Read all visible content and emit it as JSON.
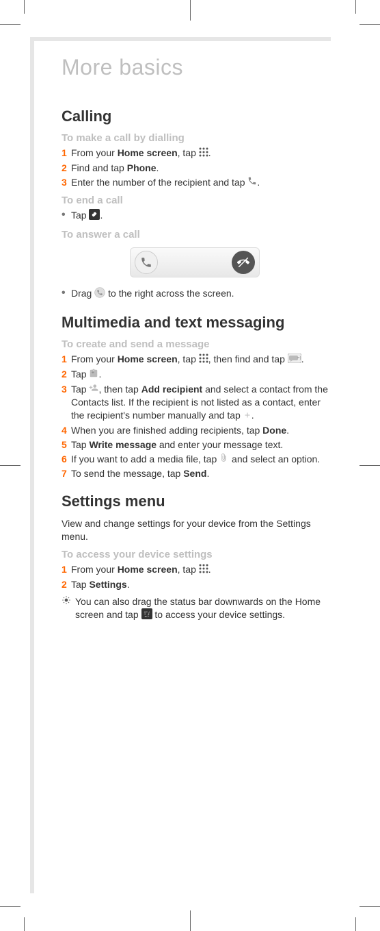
{
  "pageTitle": "More basics",
  "sections": {
    "calling": {
      "heading": "Calling",
      "subs": {
        "dial": {
          "heading": "To make a call by dialling"
        },
        "end": {
          "heading": "To end a call"
        },
        "answer": {
          "heading": "To answer a call"
        }
      },
      "dialSteps": {
        "s1a": "From your ",
        "s1b": "Home screen",
        "s1c": ", tap ",
        "s1d": ".",
        "s2a": "Find and tap ",
        "s2b": "Phone",
        "s2c": ".",
        "s3a": "Enter the number of the recipient and tap ",
        "s3b": "."
      },
      "endStep": {
        "a": "Tap ",
        "b": "."
      },
      "answerStep": {
        "a": "Drag ",
        "b": " to the right across the screen."
      }
    },
    "messaging": {
      "heading": "Multimedia and text messaging",
      "create": {
        "heading": "To create and send a message"
      },
      "steps": {
        "s1a": "From your ",
        "s1b": "Home screen",
        "s1c": ", tap ",
        "s1d": ", then find and tap ",
        "s1e": ".",
        "s2a": "Tap ",
        "s2b": ".",
        "s3a": "Tap ",
        "s3b": ", then tap ",
        "s3c": "Add recipient",
        "s3d": " and select a contact from the Contacts list. If the recipient is not listed as a contact, enter the recipient's number manually and tap ",
        "s3e": ".",
        "s4a": "When you are finished adding recipients, tap ",
        "s4b": "Done",
        "s4c": ".",
        "s5a": "Tap ",
        "s5b": "Write message",
        "s5c": " and enter your message text.",
        "s6a": "If you want to add a media file, tap ",
        "s6b": " and select an option.",
        "s7a": "To send the message, tap ",
        "s7b": "Send",
        "s7c": "."
      }
    },
    "settings": {
      "heading": "Settings menu",
      "intro": "View and change settings for your device from the Settings menu.",
      "access": {
        "heading": "To access your device settings"
      },
      "steps": {
        "s1a": "From your ",
        "s1b": "Home screen",
        "s1c": ", tap ",
        "s1d": ".",
        "s2a": "Tap ",
        "s2b": "Settings",
        "s2c": "."
      },
      "tip": {
        "a": "You can also drag the status bar downwards on the Home screen and tap ",
        "b": " to access your device settings."
      }
    }
  },
  "nums": {
    "n1": "1",
    "n2": "2",
    "n3": "3",
    "n4": "4",
    "n5": "5",
    "n6": "6",
    "n7": "7"
  },
  "bullet": "•"
}
